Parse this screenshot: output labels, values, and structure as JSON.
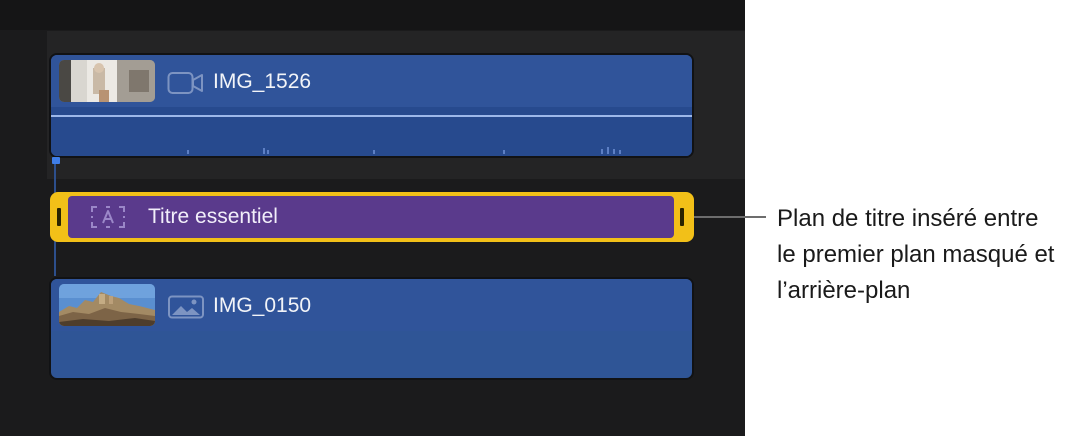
{
  "timeline": {
    "clips": {
      "video_clip": {
        "name": "IMG_1526",
        "icon": "video-camera-icon"
      },
      "title_clip": {
        "name": "Titre essentiel",
        "icon": "title-text-icon"
      },
      "photo_clip": {
        "name": "IMG_0150",
        "icon": "photo-icon"
      }
    },
    "colors": {
      "clip_blue": "#30549a",
      "title_purple": "#5a3a8c",
      "selection_yellow": "#f2c018",
      "playhead_blue": "#3f7ee8"
    }
  },
  "callout": {
    "text": "Plan de titre inséré entre le premier plan masqué et l’arrière-plan"
  }
}
